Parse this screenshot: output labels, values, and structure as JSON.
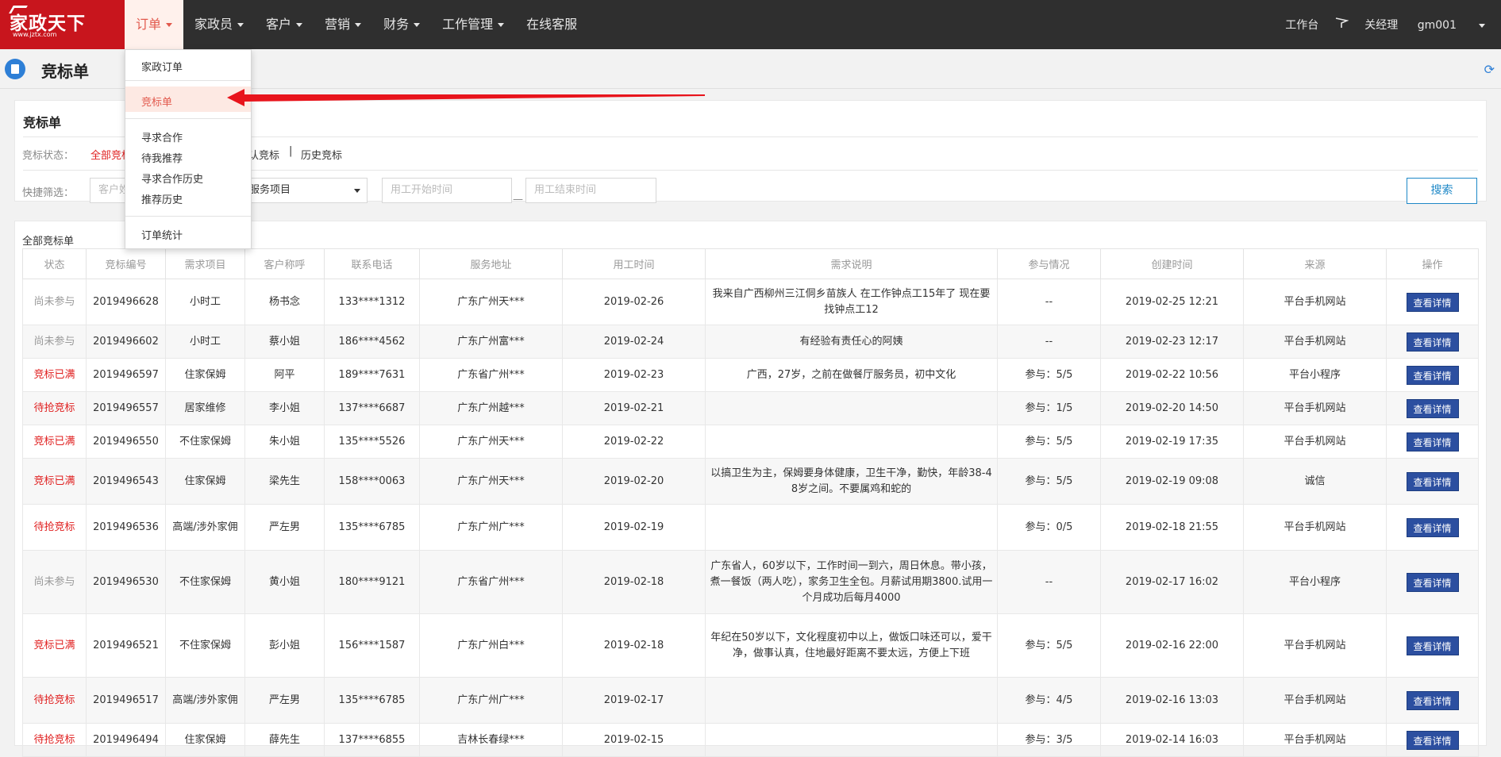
{
  "logo": {
    "text": "家政天下",
    "subtext": "www.jztx.com"
  },
  "nav": {
    "items": [
      {
        "label": "订单",
        "caret": true
      },
      {
        "label": "家政员",
        "caret": true
      },
      {
        "label": "客户",
        "caret": true
      },
      {
        "label": "营销",
        "caret": true
      },
      {
        "label": "财务",
        "caret": true
      },
      {
        "label": "工作管理",
        "caret": true
      },
      {
        "label": "在线客服",
        "caret": false
      }
    ],
    "workbench": "工作台",
    "user": "关经理",
    "account": "gm001"
  },
  "page": {
    "title": "竞标单"
  },
  "filter": {
    "panel_title": "竞标单",
    "status_label": "竞标状态：",
    "status_options": [
      "全部竞标",
      "认竞标",
      "历史竞标"
    ],
    "quick_label": "快捷筛选：",
    "customer_placeholder": "客户姓",
    "service_select": "服务项目",
    "start_placeholder": "用工开始时间",
    "end_placeholder": "用工结束时间",
    "dash": "—",
    "search_button": "搜索"
  },
  "dropdown": {
    "items": [
      "家政订单",
      "竞标单",
      "寻求合作",
      "待我推荐",
      "寻求合作历史",
      "推荐历史",
      "订单统计"
    ]
  },
  "table": {
    "caption": "全部竞标单",
    "headers": [
      "状态",
      "竞标编号",
      "需求项目",
      "客户称呼",
      "联系电话",
      "服务地址",
      "用工时间",
      "需求说明",
      "参与情况",
      "创建时间",
      "来源",
      "操作"
    ],
    "action_label": "查看详情",
    "rows": [
      {
        "status": "尚未参与",
        "status_color": "gray",
        "id": "2019496628",
        "item": "小时工",
        "customer": "杨书念",
        "phone": "133****1312",
        "address": "广东广州天***",
        "work_date": "2019-02-26",
        "desc": "我来自广西柳州三江侗乡苗族人 在工作钟点工15年了 现在要找钟点工12",
        "participation": "--",
        "created": "2019-02-25 12:21",
        "source": "平台手机网站"
      },
      {
        "status": "尚未参与",
        "status_color": "gray",
        "id": "2019496602",
        "item": "小时工",
        "customer": "蔡小姐",
        "phone": "186****4562",
        "address": "广东广州富***",
        "work_date": "2019-02-24",
        "desc": "有经验有责任心的阿姨",
        "participation": "--",
        "created": "2019-02-23 12:17",
        "source": "平台手机网站"
      },
      {
        "status": "竞标已满",
        "status_color": "red",
        "id": "2019496597",
        "item": "住家保姆",
        "customer": "阿平",
        "phone": "189****7631",
        "address": "广东省广州***",
        "work_date": "2019-02-23",
        "desc": "广西，27岁，之前在做餐厅服务员，初中文化",
        "participation": "参与：5/5",
        "created": "2019-02-22 10:56",
        "source": "平台小程序"
      },
      {
        "status": "待抢竞标",
        "status_color": "red",
        "id": "2019496557",
        "item": "居家维修",
        "customer": "李小姐",
        "phone": "137****6687",
        "address": "广东广州越***",
        "work_date": "2019-02-21",
        "desc": "",
        "participation": "参与：1/5",
        "created": "2019-02-20 14:50",
        "source": "平台手机网站"
      },
      {
        "status": "竞标已满",
        "status_color": "red",
        "id": "2019496550",
        "item": "不住家保姆",
        "customer": "朱小姐",
        "phone": "135****5526",
        "address": "广东广州天***",
        "work_date": "2019-02-22",
        "desc": "",
        "participation": "参与：5/5",
        "created": "2019-02-19 17:35",
        "source": "平台手机网站"
      },
      {
        "status": "竞标已满",
        "status_color": "red",
        "id": "2019496543",
        "item": "住家保姆",
        "customer": "梁先生",
        "phone": "158****0063",
        "address": "广东广州天***",
        "work_date": "2019-02-20",
        "desc": "以搞卫生为主，保姆要身体健康，卫生干净，勤快，年龄38-48岁之间。不要属鸡和蛇的",
        "participation": "参与：5/5",
        "created": "2019-02-19 09:08",
        "source": "诚信"
      },
      {
        "status": "待抢竞标",
        "status_color": "red",
        "id": "2019496536",
        "item": "高端/涉外家佣",
        "customer": "严左男",
        "phone": "135****6785",
        "address": "广东广州广***",
        "work_date": "2019-02-19",
        "desc": "",
        "participation": "参与：0/5",
        "created": "2019-02-18 21:55",
        "source": "平台手机网站"
      },
      {
        "status": "尚未参与",
        "status_color": "gray",
        "id": "2019496530",
        "item": "不住家保姆",
        "customer": "黄小姐",
        "phone": "180****9121",
        "address": "广东省广州***",
        "work_date": "2019-02-18",
        "desc": "广东省人，60岁以下，工作时间一到六，周日休息。带小孩，煮一餐饭（两人吃），家务卫生全包。月薪试用期3800.试用一个月成功后每月4000",
        "participation": "--",
        "created": "2019-02-17 16:02",
        "source": "平台小程序"
      },
      {
        "status": "竞标已满",
        "status_color": "red",
        "id": "2019496521",
        "item": "不住家保姆",
        "customer": "彭小姐",
        "phone": "156****1587",
        "address": "广东广州白***",
        "work_date": "2019-02-18",
        "desc": "年纪在50岁以下，文化程度初中以上，做饭口味还可以，爱干净，做事认真，住地最好距离不要太远，方便上下班",
        "participation": "参与：5/5",
        "created": "2019-02-16 22:00",
        "source": "平台手机网站"
      },
      {
        "status": "待抢竞标",
        "status_color": "red",
        "id": "2019496517",
        "item": "高端/涉外家佣",
        "customer": "严左男",
        "phone": "135****6785",
        "address": "广东广州广***",
        "work_date": "2019-02-17",
        "desc": "",
        "participation": "参与：4/5",
        "created": "2019-02-16 13:03",
        "source": "平台手机网站"
      },
      {
        "status": "待抢竞标",
        "status_color": "red",
        "id": "2019496494",
        "item": "住家保姆",
        "customer": "薛先生",
        "phone": "137****6855",
        "address": "吉林长春绿***",
        "work_date": "2019-02-15",
        "desc": "",
        "participation": "参与：3/5",
        "created": "2019-02-14 16:03",
        "source": "平台手机网站"
      }
    ]
  },
  "colors": {
    "brand_red": "#c8151d",
    "nav_bg": "#2f2f2f",
    "accent_blue": "#2c4fa0",
    "status_red": "#e02020"
  }
}
